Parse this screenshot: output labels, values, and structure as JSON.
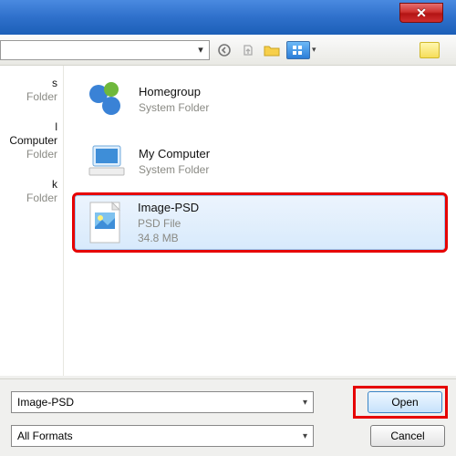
{
  "titlebar": {
    "close_glyph": "✕"
  },
  "toolbar": {
    "back_glyph": "◯",
    "up_glyph": "⇧",
    "folder_glyph": "📁",
    "views_glyph": "▦",
    "drop_glyph": "▾"
  },
  "left_items": [
    {
      "name": "s",
      "sub": "Folder"
    },
    {
      "name": "l Computer",
      "sub": "Folder"
    },
    {
      "name": "k",
      "sub": "Folder"
    }
  ],
  "items": [
    {
      "name": "Homegroup",
      "type": "System Folder",
      "size": "",
      "selected": false,
      "highlight": false
    },
    {
      "name": "My Computer",
      "type": "System Folder",
      "size": "",
      "selected": false,
      "highlight": false
    },
    {
      "name": "Image-PSD",
      "type": "PSD File",
      "size": "34.8 MB",
      "selected": true,
      "highlight": true
    }
  ],
  "filename": "Image-PSD",
  "format": "All Formats",
  "buttons": {
    "open": "Open",
    "cancel": "Cancel"
  }
}
